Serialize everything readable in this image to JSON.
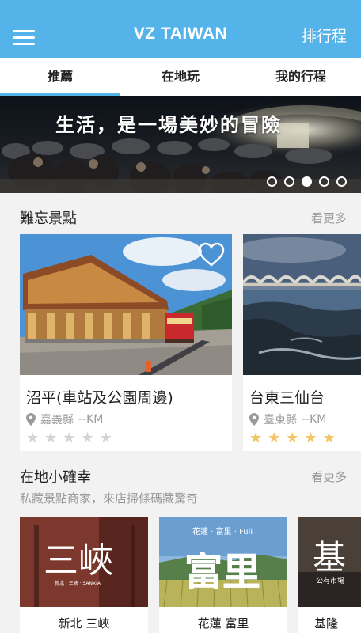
{
  "header": {
    "title": "VZ TAIWAN",
    "right_action": "排行程"
  },
  "tabs": [
    {
      "label": "推薦",
      "active": true
    },
    {
      "label": "在地玩",
      "active": false
    },
    {
      "label": "我的行程",
      "active": false
    }
  ],
  "banner": {
    "caption": "生活，是一場美妙的冒險",
    "slides": 5,
    "current_slide": 3
  },
  "sections": {
    "spots": {
      "title": "難忘景點",
      "more": "看更多",
      "cards": [
        {
          "name": "沼平(車站及公園周邊)",
          "county": "嘉義縣",
          "distance": "--KM",
          "rating": 0,
          "favorite": false
        },
        {
          "name": "台東三仙台",
          "county": "臺東縣",
          "distance": "--KM",
          "rating": 5,
          "favorite": false
        }
      ]
    },
    "local": {
      "title": "在地小確幸",
      "more": "看更多",
      "subtitle": "私藏景點商家，來店掃條碼藏驚奇",
      "cards": [
        {
          "label": "新北 三峽",
          "logo_text": "三峽",
          "logo_sub": "新北 · 三峽 · SANXIA"
        },
        {
          "label": "花蓮 富里",
          "logo_text": "富里",
          "logo_sub": "花蓮 · 富里 · Fuli"
        },
        {
          "label": "基隆",
          "logo_text": "基",
          "logo_sub": "公有市場"
        }
      ]
    }
  },
  "icons": {
    "menu": "hamburger-menu-icon",
    "heart": "heart-outline-icon",
    "pin": "map-pin-icon",
    "star": "star-icon"
  },
  "colors": {
    "primary": "#54b4ea",
    "star_lit": "#f5c463",
    "star_dim": "#d4d4d4",
    "muted_text": "#9a9a9a"
  }
}
